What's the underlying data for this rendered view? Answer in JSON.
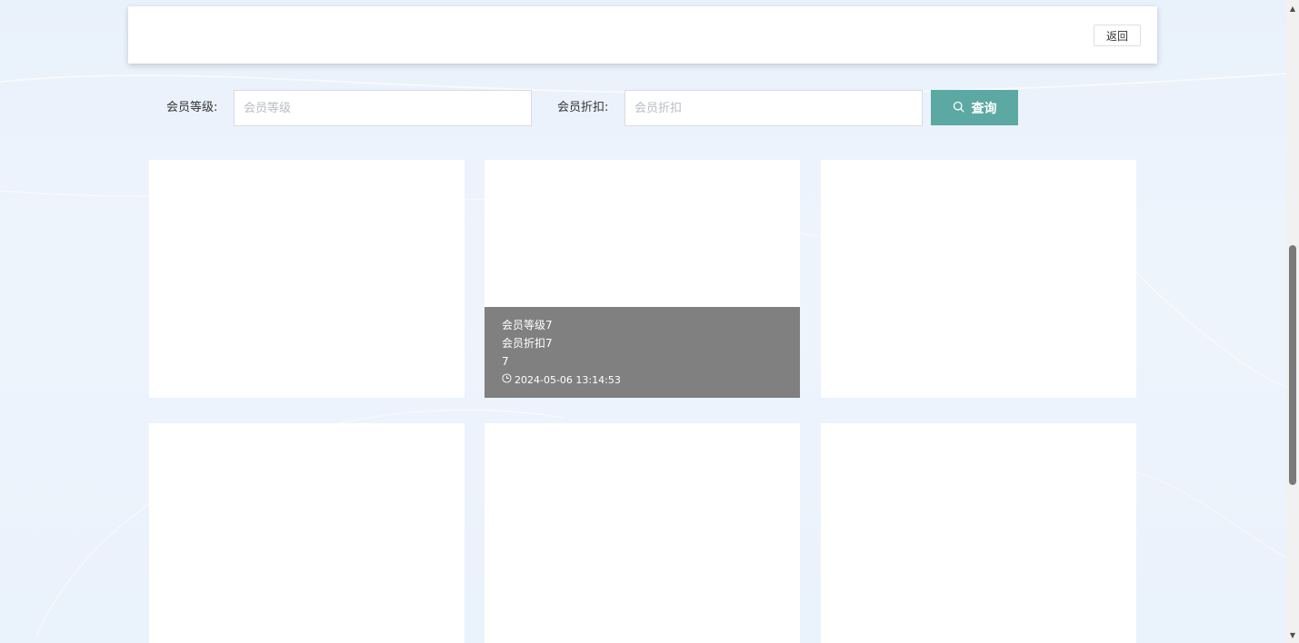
{
  "header": {
    "back_label": "返回"
  },
  "search": {
    "level_label": "会员等级:",
    "level_placeholder": "会员等级",
    "discount_label": "会员折扣:",
    "discount_placeholder": "会员折扣",
    "query_label": "查询"
  },
  "cards": [
    {
      "row": 0,
      "col": 0,
      "hovered": false
    },
    {
      "row": 0,
      "col": 1,
      "hovered": true,
      "level": "会员等级7",
      "discount": "会员折扣7",
      "value": "7",
      "time": "2024-05-06 13:14:53"
    },
    {
      "row": 0,
      "col": 2,
      "hovered": false
    },
    {
      "row": 1,
      "col": 0,
      "hovered": false
    },
    {
      "row": 1,
      "col": 1,
      "hovered": false
    },
    {
      "row": 1,
      "col": 2,
      "hovered": false
    }
  ],
  "colors": {
    "accent": "#5ca9a4",
    "overlay": "#808080",
    "background": "#eaf2fb"
  },
  "icons": {
    "search": "search-icon",
    "clock": "clock-icon"
  }
}
